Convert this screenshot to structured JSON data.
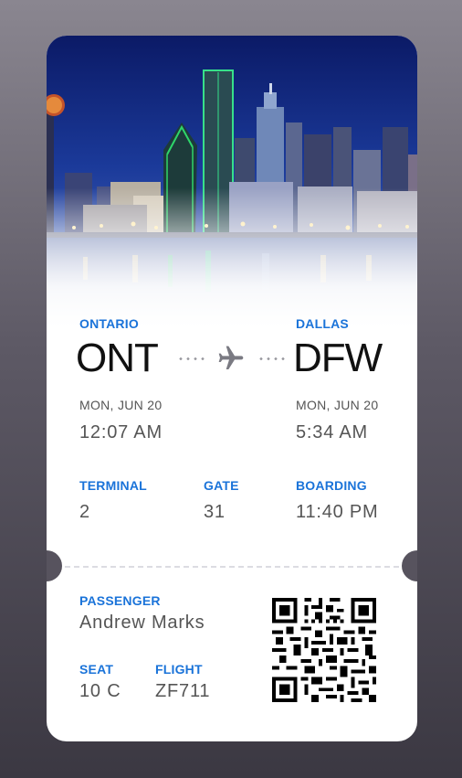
{
  "origin": {
    "city": "ONTARIO",
    "code": "ONT",
    "date": "MON, JUN 20",
    "time": "12:07 AM"
  },
  "destination": {
    "city": "DALLAS",
    "code": "DFW",
    "date": "MON, JUN 20",
    "time": "5:34 AM"
  },
  "details": {
    "terminal_label": "TERMINAL",
    "terminal": "2",
    "gate_label": "GATE",
    "gate": "31",
    "boarding_label": "BOARDING",
    "boarding": "11:40 PM"
  },
  "passenger": {
    "label": "PASSENGER",
    "name": "Andrew Marks",
    "seat_label": "SEAT",
    "seat": "10 C",
    "flight_label": "FLIGHT",
    "flight": "ZF711"
  },
  "icons": {
    "plane": "airplane-icon",
    "qr": "qr-code-icon"
  },
  "colors": {
    "accent": "#1a73d9",
    "text_primary": "#111111",
    "text_secondary": "#555555"
  }
}
